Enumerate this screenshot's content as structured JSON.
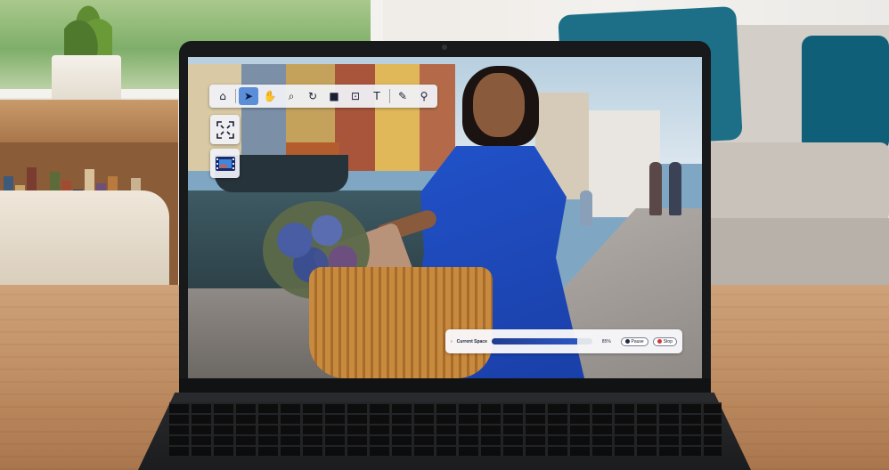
{
  "toolbar": {
    "tools": [
      {
        "name": "home-icon",
        "glyph": "⌂",
        "active": false
      },
      {
        "name": "pointer-icon",
        "glyph": "➤",
        "active": true
      },
      {
        "name": "hand-icon",
        "glyph": "✋",
        "active": false
      },
      {
        "name": "zoom-icon",
        "glyph": "⌕",
        "active": false
      },
      {
        "name": "rotate-icon",
        "glyph": "↻",
        "active": false
      },
      {
        "name": "video-icon",
        "glyph": "■",
        "active": false
      },
      {
        "name": "crop-icon",
        "glyph": "⊡",
        "active": false
      },
      {
        "name": "text-icon",
        "glyph": "T",
        "active": false
      },
      {
        "name": "pen-icon",
        "glyph": "✎",
        "active": false
      },
      {
        "name": "pin-icon",
        "glyph": "⚲",
        "active": false
      }
    ]
  },
  "side_tools": [
    {
      "name": "fit-screen-icon",
      "glyph": "⤢"
    },
    {
      "name": "filmstrip-icon",
      "glyph": "▦"
    }
  ],
  "progress": {
    "label": "Current Space",
    "percent_text": "85%",
    "fraction": 0.85,
    "pause_label": "Pause",
    "stop_label": "Stop"
  },
  "colors": {
    "accent": "#5a8ed9",
    "progress_fill": "#2d55c2",
    "stop": "#d23636"
  }
}
